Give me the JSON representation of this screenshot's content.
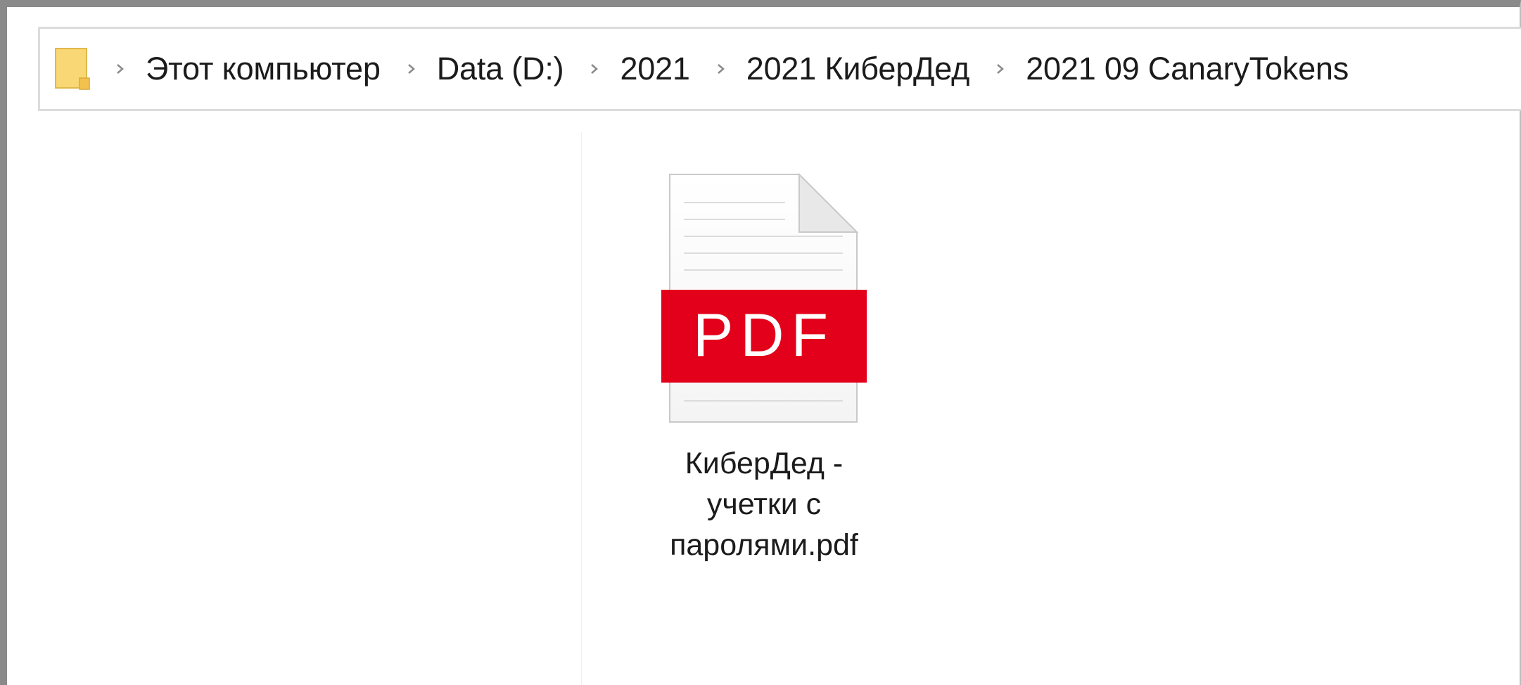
{
  "breadcrumb": {
    "items": [
      {
        "label": "Этот компьютер"
      },
      {
        "label": "Data (D:)"
      },
      {
        "label": "2021"
      },
      {
        "label": "2021 КиберДед"
      },
      {
        "label": "2021 09 CanaryTokens"
      }
    ]
  },
  "icons": {
    "address_icon": "folder-icon",
    "separator": "chevron-right-icon",
    "file_icon": "pdf-file-icon"
  },
  "files": [
    {
      "name_lines": [
        "КиберДед -",
        "учетки с",
        "паролями.pdf"
      ],
      "icon_badge": "PDF"
    }
  ],
  "colors": {
    "pdf_red": "#e3001b",
    "folder_yellow": "#f7d36b"
  }
}
